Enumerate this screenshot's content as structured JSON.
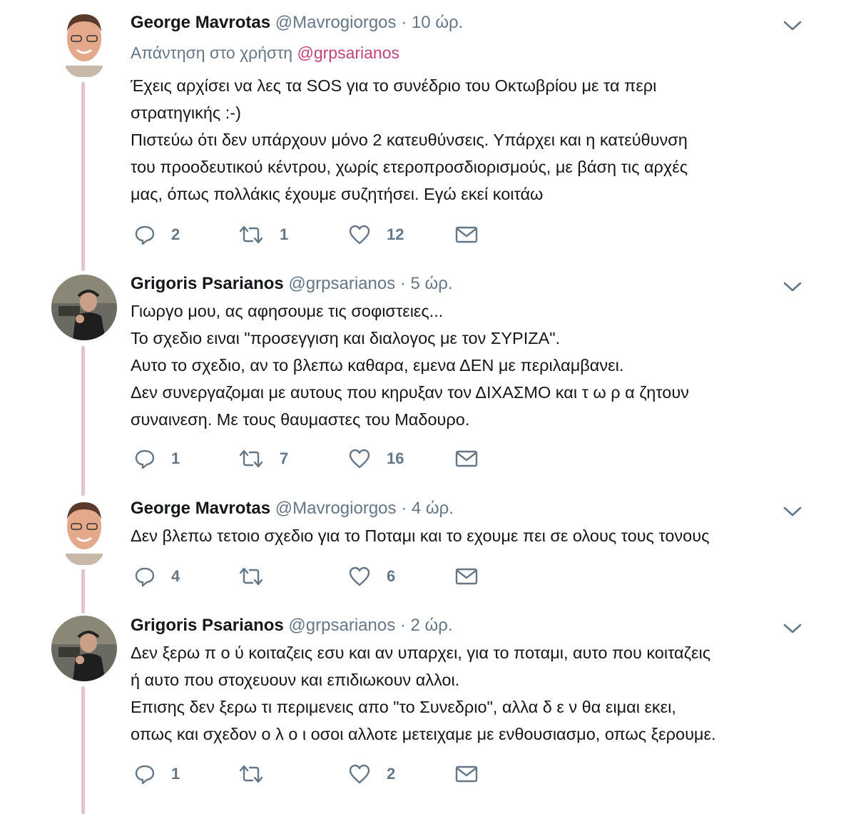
{
  "tweets": [
    {
      "name": "George Mavrotas",
      "handle": "@Mavrogiorgos",
      "time": "10 ώρ.",
      "reply_prefix": "Απάντηση στο χρήστη",
      "reply_mention": "@grpsarianos",
      "lines": [
        "Έχεις αρχίσει να λες τα SOS για το συνέδριο του Οκτωβρίου με τα περι",
        "στρατηγικής :-)",
        "Πιστεύω ότι δεν υπάρχουν μόνο 2 κατευθύνσεις. Υπάρχει και η κατεύθυνση",
        "του προοδευτικού κέντρου, χωρίς ετεροπροσδιορισμούς, με βάση τις αρχές",
        "μας, όπως πολλάκις έχουμε συζητήσει. Εγώ εκεί κοιτάω"
      ],
      "replies": "2",
      "retweets": "1",
      "likes": "12"
    },
    {
      "name": "Grigoris Psarianos",
      "handle": "@grpsarianos",
      "time": "5 ώρ.",
      "lines": [
        "Γιωργο μου,  ας αφησουμε τις σοφιστειες...",
        "Το σχεδιο ειναι \"προσεγγιση και διαλογος με τον ΣΥΡΙΖΑ\".",
        "Αυτο το σχεδιο, αν το βλεπω καθαρα, εμενα ΔΕΝ με περιλαμβανει.",
        "Δεν συνεργαζομαι με αυτους που κηρυξαν τον ΔΙΧΑΣΜΟ και τ ω ρ α ζητουν",
        "συναινεση. Με τους θαυμαστες του Μαδουρο."
      ],
      "replies": "1",
      "retweets": "7",
      "likes": "16"
    },
    {
      "name": "George Mavrotas",
      "handle": "@Mavrogiorgos",
      "time": "4 ώρ.",
      "lines": [
        "Δεν βλεπω τετοιο σχεδιο για το Ποταμι και το εχουμε πει σε ολους τους τονους"
      ],
      "replies": "4",
      "retweets": "",
      "likes": "6"
    },
    {
      "name": "Grigoris Psarianos",
      "handle": "@grpsarianos",
      "time": "2 ώρ.",
      "lines": [
        "Δεν ξερω π ο ύ κοιταζεις εσυ και αν υπαρχει, για το ποταμι, αυτο που κοιταζεις",
        "ή αυτο που στοχευουν και επιδιωκουν αλλοι.",
        "Επισης δεν ξερω τι περιμενεις απο \"το Συνεδριο\", αλλα  δ ε ν  θα ειμαι εκει,",
        "οπως και σχεδον ο λ ο ι οσοι αλλοτε μετειχαμε με ενθουσιασμο, οπως ξερουμε."
      ],
      "replies": "1",
      "retweets": "",
      "likes": "2"
    }
  ],
  "separator": "·",
  "colors": {
    "thread_line": "#e3c5d2",
    "mention": "#c2427a",
    "secondary_text": "#657786"
  },
  "icons": [
    "chevron-down-icon",
    "reply-icon",
    "retweet-icon",
    "like-icon",
    "message-icon"
  ]
}
